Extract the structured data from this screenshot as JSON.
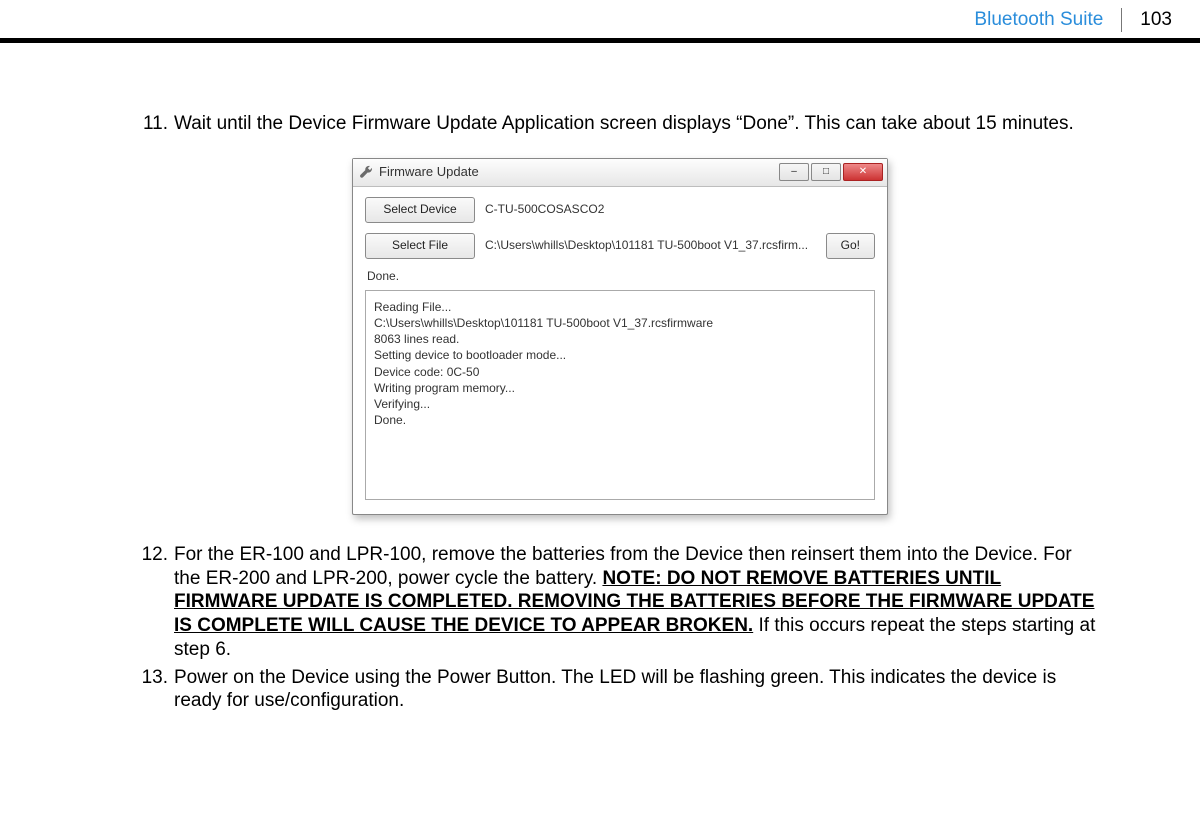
{
  "header": {
    "section_title": "Bluetooth Suite",
    "page_number": "103"
  },
  "steps": {
    "s11": {
      "num": "11.",
      "text": "Wait until the Device Firmware Update Application screen displays “Done”. This can take about 15 minutes."
    },
    "s12": {
      "num": "12.",
      "part_a": "For the ER-100 and LPR-100, remove the batteries from the Device then reinsert them into the Device. For the ER-200 and LPR-200, power cycle the battery. ",
      "note": "NOTE: DO NOT REMOVE BATTERIES UNTIL FIRMWARE UPDATE IS COMPLETED. REMOVING THE BATTERIES BEFORE THE FIRMWARE UPDATE IS COMPLETE WILL CAUSE THE DEVICE TO APPEAR BROKEN.",
      "part_b": " If this occurs repeat the steps starting at step 6."
    },
    "s13": {
      "num": "13.",
      "text": "Power on the Device using the Power Button. The LED will be flashing green. This indicates the device is ready for use/configuration."
    }
  },
  "window": {
    "title": "Firmware Update",
    "icon_name": "wrench-icon",
    "minimize": "–",
    "maximize": "□",
    "close": "✕",
    "select_device_btn": "Select Device",
    "select_file_btn": "Select File",
    "go_btn": "Go!",
    "device_value": "C-TU-500COSASCO2",
    "file_value": "C:\\Users\\whills\\Desktop\\101181 TU-500boot V1_37.rcsfirm...",
    "status": "Done.",
    "log_lines": [
      "Reading File...",
      "C:\\Users\\whills\\Desktop\\101181 TU-500boot V1_37.rcsfirmware",
      "8063 lines read.",
      "",
      "Setting device to bootloader mode...",
      "Device code: 0C-50",
      "Writing program memory...",
      "Verifying...",
      "Done."
    ]
  }
}
